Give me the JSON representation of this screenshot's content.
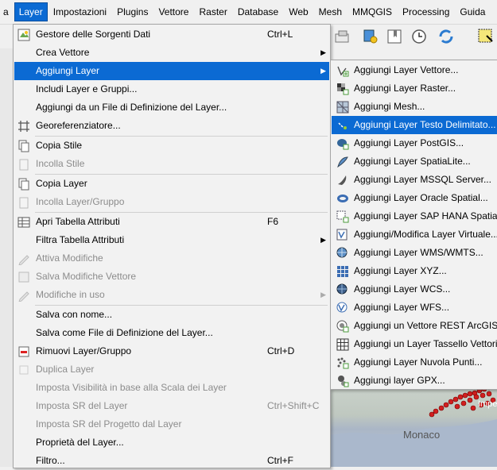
{
  "menubar": {
    "items": [
      {
        "label": "a"
      },
      {
        "label": "Layer"
      },
      {
        "label": "Impostazioni"
      },
      {
        "label": "Plugins"
      },
      {
        "label": "Vettore"
      },
      {
        "label": "Raster"
      },
      {
        "label": "Database"
      },
      {
        "label": "Web"
      },
      {
        "label": "Mesh"
      },
      {
        "label": "MMQGIS"
      },
      {
        "label": "Processing"
      },
      {
        "label": "Guida"
      }
    ]
  },
  "layer_menu": {
    "items": [
      {
        "label": "Gestore delle Sorgenti Dati",
        "shortcut": "Ctrl+L"
      },
      {
        "label": "Crea Vettore"
      },
      {
        "label": "Aggiungi Layer"
      },
      {
        "label": "Includi Layer e Gruppi..."
      },
      {
        "label": "Aggiungi da un File di Definizione del Layer..."
      },
      {
        "label": "Georeferenziatore..."
      },
      {
        "label": "Copia Stile"
      },
      {
        "label": "Incolla Stile"
      },
      {
        "label": "Copia Layer"
      },
      {
        "label": "Incolla Layer/Gruppo"
      },
      {
        "label": "Apri Tabella Attributi",
        "shortcut": "F6"
      },
      {
        "label": "Filtra Tabella Attributi"
      },
      {
        "label": "Attiva Modifiche"
      },
      {
        "label": "Salva Modifiche Vettore"
      },
      {
        "label": "Modifiche in uso"
      },
      {
        "label": "Salva con nome..."
      },
      {
        "label": "Salva come File di Definizione del Layer..."
      },
      {
        "label": "Rimuovi Layer/Gruppo",
        "shortcut": "Ctrl+D"
      },
      {
        "label": "Duplica Layer"
      },
      {
        "label": "Imposta Visibilità in base alla Scala dei Layer"
      },
      {
        "label": "Imposta SR del Layer",
        "shortcut": "Ctrl+Shift+C"
      },
      {
        "label": "Imposta SR del Progetto dal Layer"
      },
      {
        "label": "Proprietà del Layer..."
      },
      {
        "label": "Filtro...",
        "shortcut": "Ctrl+F"
      }
    ]
  },
  "add_layer_submenu": {
    "items": [
      {
        "label": "Aggiungi Layer Vettore..."
      },
      {
        "label": "Aggiungi Layer Raster..."
      },
      {
        "label": "Aggiungi Mesh..."
      },
      {
        "label": "Aggiungi Layer Testo Delimitato..."
      },
      {
        "label": "Aggiungi Layer PostGIS..."
      },
      {
        "label": "Aggiungi Layer SpatiaLite..."
      },
      {
        "label": "Aggiungi Layer MSSQL Server..."
      },
      {
        "label": "Aggiungi Layer Oracle Spatial..."
      },
      {
        "label": "Aggiungi Layer SAP HANA Spatial..."
      },
      {
        "label": "Aggiungi/Modifica Layer Virtuale..."
      },
      {
        "label": "Aggiungi Layer WMS/WMTS..."
      },
      {
        "label": "Aggiungi Layer XYZ..."
      },
      {
        "label": "Aggiungi Layer WCS..."
      },
      {
        "label": "Aggiungi Layer WFS..."
      },
      {
        "label": "Aggiungi un Vettore REST ArcGIS..."
      },
      {
        "label": "Aggiungi un Layer Tassello Vettoriale..."
      },
      {
        "label": "Aggiungi Layer Nuvola Punti..."
      },
      {
        "label": "Aggiungi layer GPX..."
      }
    ]
  },
  "map": {
    "place_labels": [
      "Monaco",
      "Impe"
    ]
  },
  "colors": {
    "selection": "#0b6ad3",
    "menu_bg": "#f2f2f2",
    "disabled_text": "#8c8c8c"
  },
  "icons": {
    "submenu_arrow": "chevron-right-icon"
  }
}
